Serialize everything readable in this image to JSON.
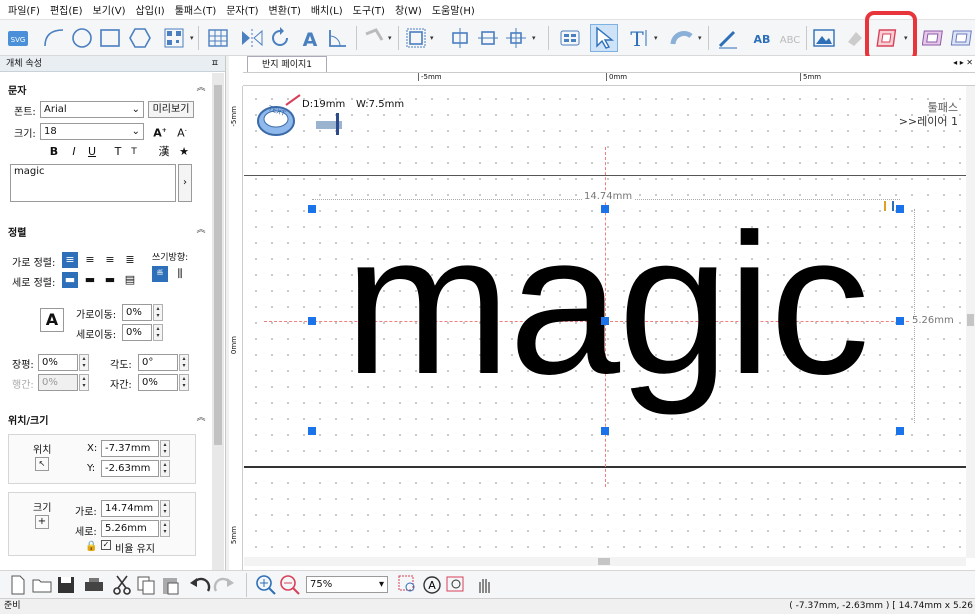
{
  "menu": [
    "파일(F)",
    "편집(E)",
    "보기(V)",
    "삽입(I)",
    "툴패스(T)",
    "문자(T)",
    "변환(T)",
    "배치(L)",
    "도구(T)",
    "창(W)",
    "도움말(H)"
  ],
  "toolbar": {
    "svg_label": "SVG",
    "text_tool": "T",
    "ab_label": "AB"
  },
  "panel": {
    "title": "개체 속성",
    "pin": "ㅍ",
    "text_section": "문자",
    "font_label": "폰트:",
    "font_value": "Arial",
    "preview_button": "미리보기",
    "size_label": "크기:",
    "size_value": "18",
    "style_buttons": [
      "B",
      "I",
      "U",
      "T",
      "T"
    ],
    "hanja": "漢",
    "text_content": "magic",
    "align_section": "정렬",
    "h_align_label": "가로 정렬:",
    "v_align_label": "세로 정렬:",
    "writing_dir_label": "쓰기방향:",
    "h_move_label": "가로이동:",
    "h_move_value": "0%",
    "v_move_label": "세로이동:",
    "v_move_value": "0%",
    "jangpyeong_label": "장평:",
    "jangpyeong_value": "0%",
    "angle_label": "각도:",
    "angle_value": "0°",
    "line_spacing_label": "행간:",
    "line_spacing_value": "0%",
    "char_spacing_label": "자간:",
    "char_spacing_value": "0%",
    "pos_section": "위치/크기",
    "position_label": "위치",
    "x_label": "X:",
    "x_value": "-7.37mm",
    "y_label": "Y:",
    "y_value": "-2.63mm",
    "size_group_label": "크기",
    "width_label": "가로:",
    "width_value": "14.74mm",
    "height_label": "세로:",
    "height_value": "5.26mm",
    "keep_ratio": "비율 유지"
  },
  "canvas": {
    "tab": "반지 페이지1",
    "ruler_h": [
      "-5mm",
      "0mm",
      "5mm"
    ],
    "ruler_v": [
      "-5mm",
      "0mm",
      "5mm"
    ],
    "ring_d": "D:19mm",
    "ring_w": "W:7.5mm",
    "ring_badge": "TEXT",
    "toolpath": "툴패스",
    "layer": ">>레이어 1",
    "main_text": "magic",
    "dim_width": "14.74mm",
    "dim_height": "5.26mm"
  },
  "bottom": {
    "zoom": "75%"
  },
  "status": {
    "left": "준비",
    "right": "( -7.37mm, -2.63mm ) [ 14.74mm x 5.26"
  },
  "colors": {
    "handle": "#1a73e8",
    "highlight": "#e8353b",
    "guide": "#f08080"
  }
}
